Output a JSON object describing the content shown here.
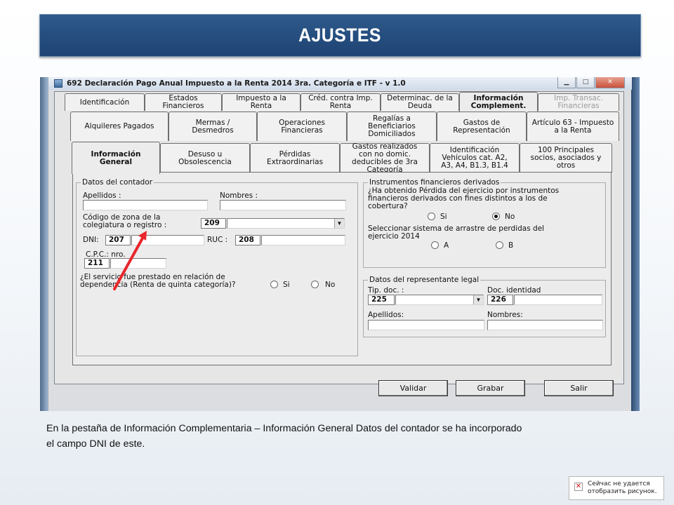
{
  "slide_title": "AJUSTES",
  "window": {
    "title": "692 Declaración Pago Anual Impuesto a la Renta 2014 3ra. Categoría e ITF - v 1.0",
    "min_icon": "minimize-icon",
    "max_icon": "maximize-icon",
    "close_icon": "close-icon"
  },
  "tabs_row1": [
    {
      "label": "Identificación"
    },
    {
      "label": "Estados\nFinancieros"
    },
    {
      "label": "Impuesto a la\nRenta"
    },
    {
      "label": "Créd. contra Imp.\nRenta"
    },
    {
      "label": "Determinac. de la\nDeuda"
    },
    {
      "label": "Información\nComplement."
    },
    {
      "label": "Imp. Transac.\nFinancieras"
    }
  ],
  "tabs_row2": [
    {
      "label": "Alquileres Pagados"
    },
    {
      "label": "Mermas /\nDesmedros"
    },
    {
      "label": "Operaciones\nFinancieras"
    },
    {
      "label": "Regalías a\nBeneficiarios\nDomiciliados"
    },
    {
      "label": "Gastos de\nRepresentación"
    },
    {
      "label": "Artículo 63 - Impuesto\na la Renta"
    }
  ],
  "tabs_row3": [
    {
      "label": "Información\nGeneral"
    },
    {
      "label": "Desuso u\nObsolescencia"
    },
    {
      "label": "Pérdidas\nExtraordinarias"
    },
    {
      "label": "Gastos realizados\ncon no domic.\ndeducibles de 3ra\nCategoría"
    },
    {
      "label": "Identificación\nVehículos cat. A2,\nA3, A4, B1.3, B1.4"
    },
    {
      "label": "100 Principales\nsocios, asociados y\notros"
    }
  ],
  "contador": {
    "group_label": "Datos del contador",
    "apellidos_label": "Apellidos :",
    "nombres_label": "Nombres :",
    "zona_label": "Código de zona de la\ncolegiatura o registro :",
    "zona_code": "209",
    "dni_label": "DNI:",
    "dni_code": "207",
    "ruc_label": "RUC :",
    "ruc_code": "208",
    "cpc_label": "C.P.C.: nro.",
    "cpc_code": "211",
    "servicio_question": "¿El servicio fue prestado en relación de\ndependencia (Renta de quinta categoría)?",
    "opt_si": "Si",
    "opt_no": "No"
  },
  "instrumentos": {
    "group_label": "Instrumentos financieros derivados",
    "question": "¿Ha obtenido Pérdida del ejercicio por instrumentos\nfinancieros derivados con fines distintos a los de\ncobertura?",
    "opt_si": "Si",
    "opt_no": "No",
    "selected": "No",
    "arrastre_question": "Seleccionar sistema de arrastre de perdidas del\nejercicio 2014",
    "opt_a": "A",
    "opt_b": "B"
  },
  "representante": {
    "group_label": "Datos del representante legal",
    "tip_doc_label": "Tip. doc. :",
    "tip_doc_code": "225",
    "doc_id_label": "Doc. identidad",
    "doc_id_code": "226",
    "apellidos_label": "Apellidos:",
    "nombres_label": "Nombres:"
  },
  "buttons": {
    "validar": "Validar",
    "grabar": "Grabar",
    "salir": "Salir"
  },
  "annotation_color": "#e8262b",
  "caption_line1": "En la pestaña de Información Complementaria – Información General Datos del contador se ha incorporado",
  "caption_line2": "el campo  DNI de este.",
  "broken_image": {
    "line1": "Сейчас не удается",
    "line2": "отобразить рисунок.",
    "icon": "broken-image-icon"
  }
}
